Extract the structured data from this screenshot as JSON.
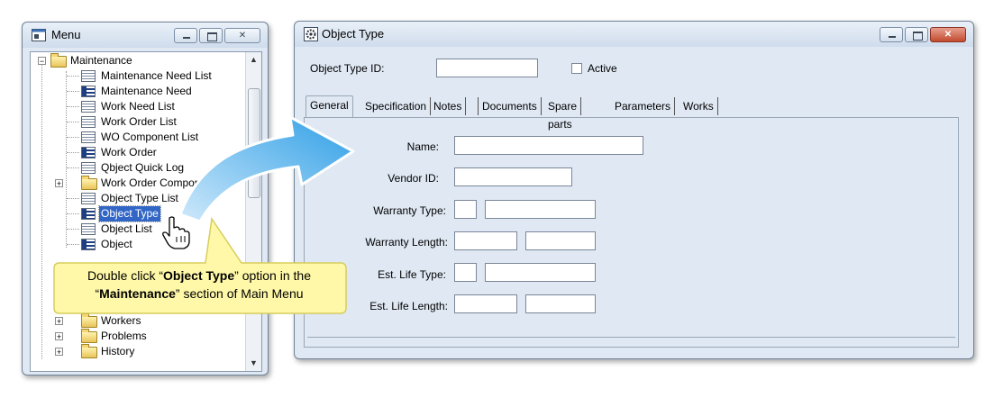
{
  "menu_window": {
    "title": "Menu",
    "tree": [
      {
        "label": "Maintenance",
        "kind": "folder",
        "expanded": true
      },
      {
        "label": "Maintenance Need List",
        "kind": "list"
      },
      {
        "label": "Maintenance Need",
        "kind": "form"
      },
      {
        "label": "Work Need List",
        "kind": "list"
      },
      {
        "label": "Work Order List",
        "kind": "list"
      },
      {
        "label": "WO Component List",
        "kind": "list"
      },
      {
        "label": "Work Order",
        "kind": "form"
      },
      {
        "label": "Qbject Quick Log",
        "kind": "list"
      },
      {
        "label": "Work Order Componer",
        "kind": "folder",
        "expanded": false
      },
      {
        "label": "Object Type List",
        "kind": "list"
      },
      {
        "label": "Object Type",
        "kind": "form",
        "selected": true
      },
      {
        "label": "Object List",
        "kind": "list"
      },
      {
        "label": "Object",
        "kind": "form"
      },
      {
        "label": "Workers",
        "kind": "folder",
        "expanded": false
      },
      {
        "label": "Problems",
        "kind": "folder",
        "expanded": false
      },
      {
        "label": "History",
        "kind": "folder",
        "expanded": false
      }
    ]
  },
  "object_type_window": {
    "title": "Object Type",
    "id_label": "Object Type ID:",
    "id_value": "",
    "active_label": "Active",
    "active_checked": false,
    "tabs": [
      "General",
      "Specification",
      "Notes",
      "Documents",
      "Spare parts",
      "Parameters",
      "Works"
    ],
    "active_tab": "General",
    "fields": {
      "name": "Name:",
      "vendor_id": "Vendor ID:",
      "warranty_type": "Warranty Type:",
      "warranty_length": "Warranty Length:",
      "est_life_type": "Est. Life Type:",
      "est_life_length": "Est. Life Length:"
    }
  },
  "callout": {
    "prefix": "Double click “",
    "option": "Object Type",
    "middle": "” option in the",
    "line2_prefix": "“",
    "section": "Maintenance",
    "suffix": "” section of Main Menu"
  },
  "colors": {
    "selection": "#3166c6",
    "arrow": "#2f9fe6",
    "callout_fill": "#fff8a8",
    "window_bg": "#dfe8f3"
  },
  "icons": {
    "menu_title": "menu-window-icon",
    "object_title": "gear-window-icon",
    "cursor": "hand-pointer-icon"
  }
}
